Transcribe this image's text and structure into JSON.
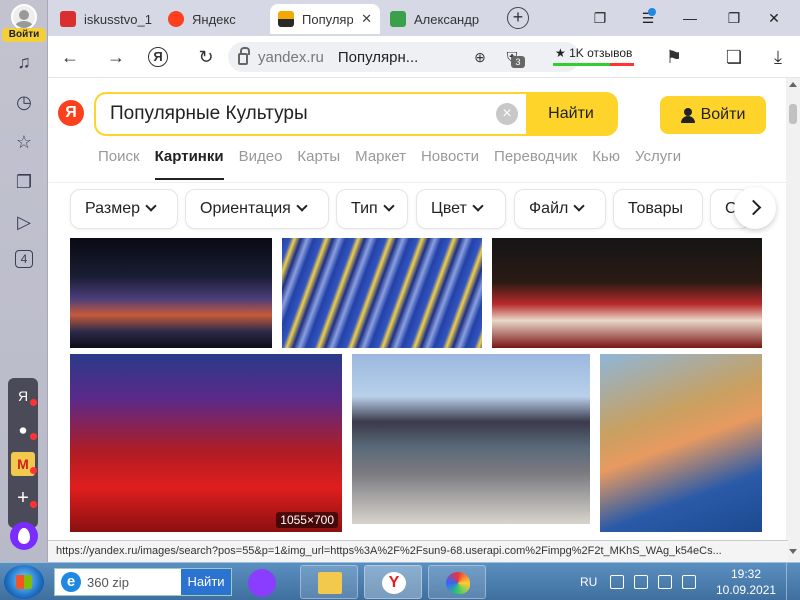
{
  "side_panel": {
    "login_badge": "Войти",
    "tab_count": "4",
    "mini_apps": [
      "Я",
      "⏺",
      "M",
      "+"
    ]
  },
  "tabs": [
    {
      "title": "iskusstvo_1",
      "favicon_color": "#d9302f"
    },
    {
      "title": "Яндекс",
      "favicon_color": "#fc3f1d"
    },
    {
      "title": "Популяр",
      "favicon_color": "#f2a900",
      "active": true
    },
    {
      "title": "Александр",
      "favicon_color": "#3aa14a"
    }
  ],
  "address": {
    "domain": "yandex.ru",
    "page_title": "Популярн...",
    "tab_badge": "3",
    "reviews": "★ 1K отзывов"
  },
  "search": {
    "logo": "Я",
    "query": "Популярные Культуры",
    "clear": "×",
    "button": "Найти",
    "login": "Войти"
  },
  "services": [
    "Поиск",
    "Картинки",
    "Видео",
    "Карты",
    "Маркет",
    "Новости",
    "Переводчик",
    "Кью",
    "Услуги"
  ],
  "active_service": "Картинки",
  "filters": [
    "Размер",
    "Ориентация",
    "Тип",
    "Цвет",
    "Файл",
    "Товары",
    "С"
  ],
  "images": {
    "size_badge": "1055×700"
  },
  "status_url": "https://yandex.ru/images/search?pos=55&p=1&img_url=https%3A%2F%2Fsun9-68.userapi.com%2Fimpg%2F2t_MKhS_WAg_k54eCs...",
  "taskbar": {
    "search_placeholder": "360 zip",
    "search_button": "Найти",
    "lang": "RU",
    "time": "19:32",
    "date": "10.09.2021"
  },
  "colors": {
    "accent_yellow": "#fed42b",
    "yandex_red": "#fc3f1d"
  }
}
